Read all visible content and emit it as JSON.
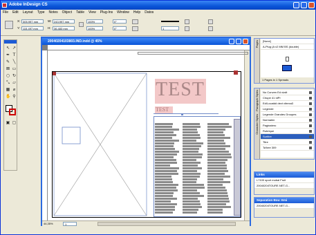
{
  "app": {
    "title": "Adobe InDesign CS"
  },
  "menubar": [
    "File",
    "Edit",
    "Layout",
    "Type",
    "Notes",
    "Object",
    "Table",
    "View",
    "Plug-Ins",
    "Window",
    "Help",
    "Datos"
  ],
  "control": {
    "x_value": "305,997 mm",
    "y_value": "115,497 mm",
    "w_value": "243,997 mm",
    "h_value": "36,483 mm",
    "scale_x": "100%",
    "scale_y": "100%",
    "rotate": "0°",
    "shear": "0°",
    "stroke_weight": "1"
  },
  "document": {
    "title": "20040204103803.IND.indd @ 45%",
    "zoom": "44,35%",
    "page_number": "1",
    "heading_text": "TEST",
    "small_text": "TEST"
  },
  "pages_panel": {
    "tab_label": "Pages",
    "items": [
      "[None]",
      "A-Plug (A v2 MM BS (double)"
    ],
    "footer": "1 Pages in 1 Spreads"
  },
  "styles_panel": {
    "tabs": [
      "Paragraph Styles",
      "Character Styles",
      "Swatches",
      "Stroke"
    ],
    "items": [
      {
        "label": "No Conven Ed vizdt",
        "selected": false
      },
      {
        "label": "Chupe 41 IdPr",
        "selected": false
      },
      {
        "label": "Ed/Locatdd devt vitrexa3",
        "selected": false
      },
      {
        "label": "Legende",
        "selected": false
      },
      {
        "label": "Legende Grandes Groupes",
        "selected": false
      },
      {
        "label": "Normalen",
        "selected": false
      },
      {
        "label": "Paginatero",
        "selected": false
      },
      {
        "label": "Rubrique",
        "selected": false
      },
      {
        "label": "Surtitre",
        "selected": true
      },
      {
        "label": "Titre",
        "selected": false
      },
      {
        "label": "Ta'bee 309",
        "selected": false
      }
    ]
  },
  "links_panel": {
    "title": "Links",
    "items": [
      "L7100 sport mobal Fruit",
      "20040204TOURE.NET-G..."
    ]
  },
  "layers_panel": {
    "title": "Separation Bou: Emi",
    "items": [
      "20040204TOURE.NET-G..."
    ]
  }
}
